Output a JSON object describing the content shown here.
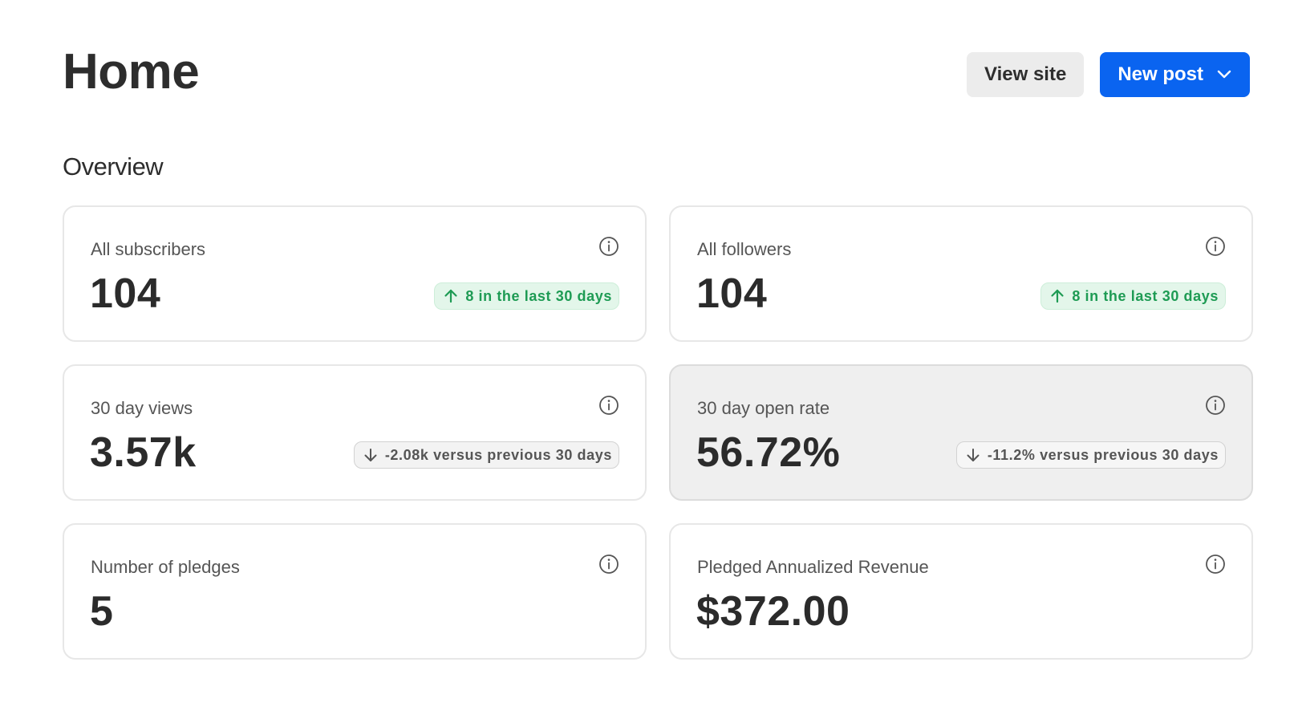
{
  "header": {
    "title": "Home",
    "view_site_label": "View site",
    "new_post_label": "New post"
  },
  "overview": {
    "title": "Overview",
    "cards": [
      {
        "label": "All subscribers",
        "value": "104",
        "badge": {
          "trend": "up",
          "text": "8 in the last 30 days"
        }
      },
      {
        "label": "All followers",
        "value": "104",
        "badge": {
          "trend": "up",
          "text": "8 in the last 30 days"
        }
      },
      {
        "label": "30 day views",
        "value": "3.57k",
        "badge": {
          "trend": "down",
          "text": "-2.08k versus previous 30 days"
        }
      },
      {
        "label": "30 day open rate",
        "value": "56.72%",
        "highlighted": true,
        "badge": {
          "trend": "down",
          "text": "-11.2% versus previous 30 days"
        }
      },
      {
        "label": "Number of pledges",
        "value": "5"
      },
      {
        "label": "Pledged Annualized Revenue",
        "value": "$372.00"
      }
    ]
  },
  "colors": {
    "primary": "#0a64f0",
    "positive": "#1e9b54",
    "positive_bg": "#e3f6ea",
    "neutral_badge_bg": "#f3f3f3",
    "card_border": "#e7e7e7",
    "card_highlight_bg": "#efefef"
  },
  "icons": {
    "info": "info-circle-icon",
    "trend_up": "arrow-up-icon",
    "trend_down": "arrow-down-icon",
    "dropdown": "chevron-down-icon"
  }
}
